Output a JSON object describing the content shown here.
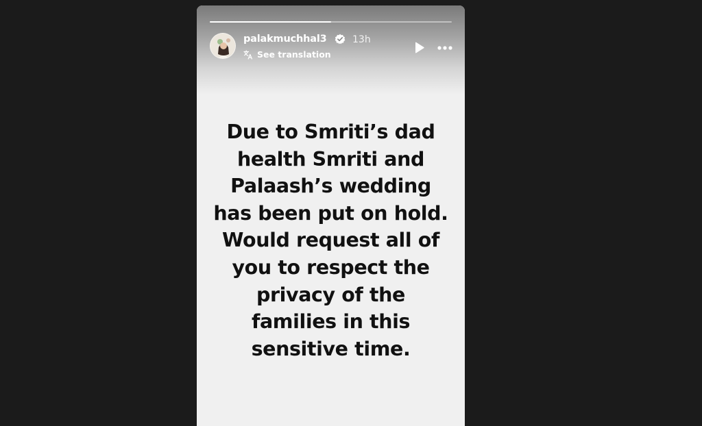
{
  "story": {
    "progress_fraction": 0.5,
    "author": {
      "username": "palakmuchhal3",
      "verified": true,
      "posted_ago": "13h"
    },
    "see_translation_label": "See translation",
    "controls": {
      "play_icon": "play-icon",
      "more_icon": "more-options-icon"
    },
    "text": "Due to Smriti’s dad\nhealth Smriti and\nPalaash’s wedding\nhas been put on hold.\nWould request all of\nyou to respect the\nprivacy of the\nfamilies in this\nsensitive time.",
    "colors": {
      "page_background": "#1b1b1b",
      "story_background": "#f0f0f0",
      "text": "#111111",
      "verified_badge": "#ffffff"
    }
  }
}
